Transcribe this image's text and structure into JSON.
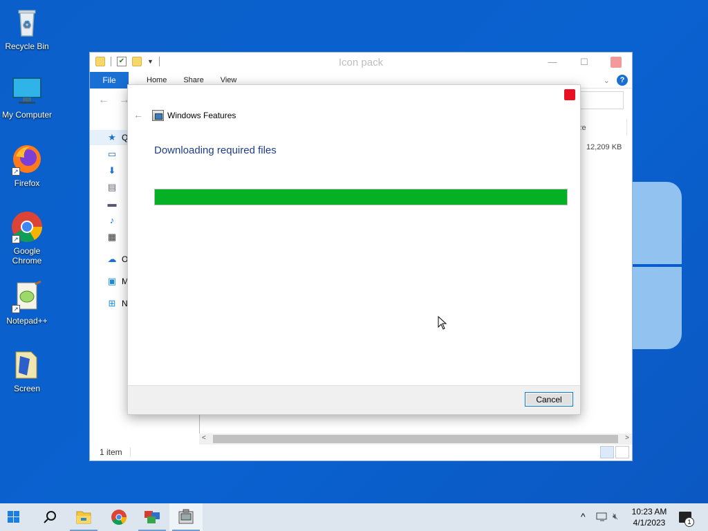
{
  "desktop": {
    "icons": [
      {
        "label": "Recycle Bin"
      },
      {
        "label": "My Computer"
      },
      {
        "label": "Firefox"
      },
      {
        "label": "Google Chrome"
      },
      {
        "label": "Notepad++"
      },
      {
        "label": "Screen"
      }
    ]
  },
  "explorer": {
    "title": "Icon pack",
    "ribbon": {
      "file": "File",
      "tabs": [
        "Home",
        "Share",
        "View"
      ],
      "help": "?"
    },
    "sidebar": [
      "Q",
      "O",
      "M",
      "N"
    ],
    "column_header": "ze",
    "size_value": "12,209 KB",
    "status": "1 item"
  },
  "dialog": {
    "app_title": "Windows Features",
    "heading": "Downloading required files",
    "progress_fraction": 1.0,
    "progress_color": "#06b025",
    "cancel_label": "Cancel"
  },
  "taskbar": {
    "apps": [
      "start-icon",
      "search-icon",
      "file-explorer-icon",
      "chrome-icon",
      "features-icon",
      "installer-icon"
    ],
    "time": "10:23 AM",
    "date": "4/1/2023",
    "notification_count": "1"
  }
}
